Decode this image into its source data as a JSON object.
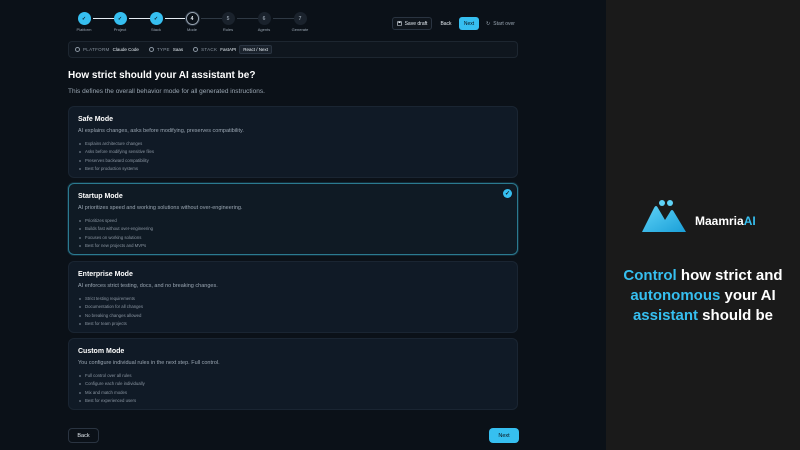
{
  "stepper": {
    "steps": [
      {
        "label": "Platform",
        "state": "done"
      },
      {
        "label": "Project",
        "state": "done"
      },
      {
        "label": "Stack",
        "state": "done"
      },
      {
        "label": "Mode",
        "number": "4",
        "state": "current"
      },
      {
        "label": "Rules",
        "number": "5",
        "state": "todo"
      },
      {
        "label": "Agents",
        "number": "6",
        "state": "todo"
      },
      {
        "label": "Generate",
        "number": "7",
        "state": "todo"
      }
    ]
  },
  "toolbar": {
    "save_draft": "Save draft",
    "back": "Back",
    "next": "Next",
    "start_over": "Start over"
  },
  "context": {
    "platform_key": "PLATFORM",
    "platform_val": "Claude Code",
    "type_key": "TYPE",
    "type_val": "Saas",
    "stack_key": "STACK",
    "stack_val": "FastAPI",
    "stack_chip": "React / Next"
  },
  "main": {
    "title": "How strict should your AI assistant be?",
    "subtitle": "This defines the overall behavior mode for all generated instructions."
  },
  "modes": [
    {
      "title": "Safe Mode",
      "desc": "AI explains changes, asks before modifying, preserves compatibility.",
      "items": [
        "Explains architecture changes",
        "Asks before modifying sensitive files",
        "Preserves backward compatibility",
        "Best for production systems"
      ],
      "selected": false
    },
    {
      "title": "Startup Mode",
      "desc": "AI prioritizes speed and working solutions without over-engineering.",
      "items": [
        "Prioritizes speed",
        "Builds fast without over-engineering",
        "Focuses on working solutions",
        "Best for new projects and MVPs"
      ],
      "selected": true
    },
    {
      "title": "Enterprise Mode",
      "desc": "AI enforces strict testing, docs, and no breaking changes.",
      "items": [
        "Strict testing requirements",
        "Documentation for all changes",
        "No breaking changes allowed",
        "Best for team projects"
      ],
      "selected": false
    },
    {
      "title": "Custom Mode",
      "desc": "You configure individual rules in the next step. Full control.",
      "items": [
        "Full control over all rules",
        "Configure each rule individually",
        "Mix and match modes",
        "Best for experienced users"
      ],
      "selected": false
    }
  ],
  "footer": {
    "back": "Back",
    "next": "Next"
  },
  "promo": {
    "brand_main": "Maamria",
    "brand_accent": "AI",
    "tag_1": "Control",
    "tag_2": " how strict and ",
    "tag_3": "autonomous",
    "tag_4": " your AI ",
    "tag_5": "assistant",
    "tag_6": " should be"
  },
  "colors": {
    "accent": "#36bff0",
    "background": "#0b1118",
    "card": "#101a26"
  }
}
